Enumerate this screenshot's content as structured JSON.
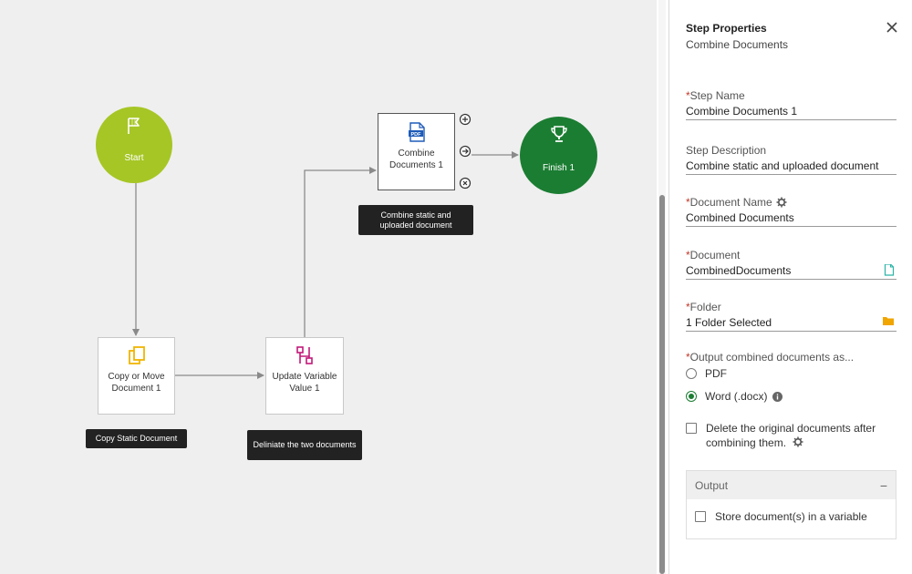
{
  "canvas": {
    "start": {
      "label": "Start",
      "icon": "flag-icon"
    },
    "finish": {
      "label": "Finish 1",
      "icon": "trophy-icon"
    },
    "nodes": {
      "copy_move": {
        "label": "Copy or Move Document 1",
        "icon": "copy-files-icon",
        "note": "Copy Static Document"
      },
      "update_variable": {
        "label": "Update Variable Value 1",
        "icon": "variable-icon",
        "note": "Deliniate the two documents"
      },
      "combine": {
        "label": "Combine Documents 1",
        "icon": "pdf-icon",
        "note": "Combine static and uploaded document"
      }
    },
    "colors": {
      "start": "#a6c625",
      "finish": "#1b7d32",
      "copy_icon": "#f0b400",
      "variable_icon": "#c2187a",
      "pdf_icon": "#1e5bb8"
    }
  },
  "panel": {
    "title": "Step Properties",
    "subtitle": "Combine Documents",
    "required_marker": "*",
    "fields": {
      "step_name": {
        "label": "Step Name",
        "value": "Combine Documents 1"
      },
      "step_description": {
        "label": "Step Description",
        "value": "Combine static and uploaded document"
      },
      "document_name": {
        "label": "Document Name",
        "value": "Combined Documents"
      },
      "document": {
        "label": "Document",
        "value": "CombinedDocuments"
      },
      "folder": {
        "label": "Folder",
        "value": "1 Folder Selected"
      }
    },
    "output_format": {
      "label": "Output combined documents as...",
      "options": [
        {
          "label": "PDF",
          "selected": false
        },
        {
          "label": "Word (.docx)",
          "selected": true
        }
      ]
    },
    "delete_originals": {
      "label": "Delete the original documents after combining them.",
      "checked": false
    },
    "output": {
      "title": "Output",
      "collapse_symbol": "−",
      "store_variable": {
        "label": "Store document(s) in a variable",
        "checked": false
      }
    }
  }
}
